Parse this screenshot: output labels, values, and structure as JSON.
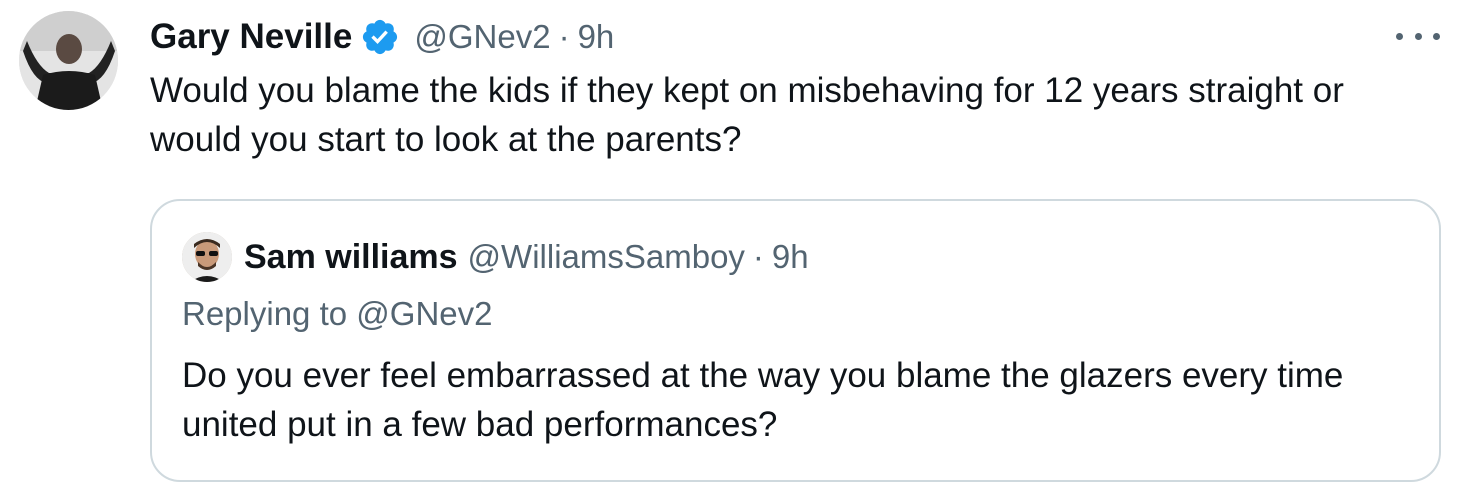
{
  "tweet": {
    "author_name": "Gary Neville",
    "verified_icon": "verified-badge-icon",
    "handle": "@GNev2",
    "separator": "·",
    "time": "9h",
    "more_icon": "more-options-icon",
    "text": "Would you blame the kids if they kept on misbehaving for 12 years straight or would you start to look at the parents?"
  },
  "quoted_tweet": {
    "author_name": "Sam williams",
    "handle": "@WilliamsSamboy",
    "separator": "·",
    "time": "9h",
    "replying_prefix": "Replying to",
    "replying_to": "@GNev2",
    "text": "Do you ever feel embarrassed at the way you blame the glazers every time united put in a few bad performances?"
  },
  "colors": {
    "text_primary": "#0f1419",
    "text_secondary": "#536471",
    "verified_blue": "#1d9bf0",
    "border": "#cfd9de"
  }
}
